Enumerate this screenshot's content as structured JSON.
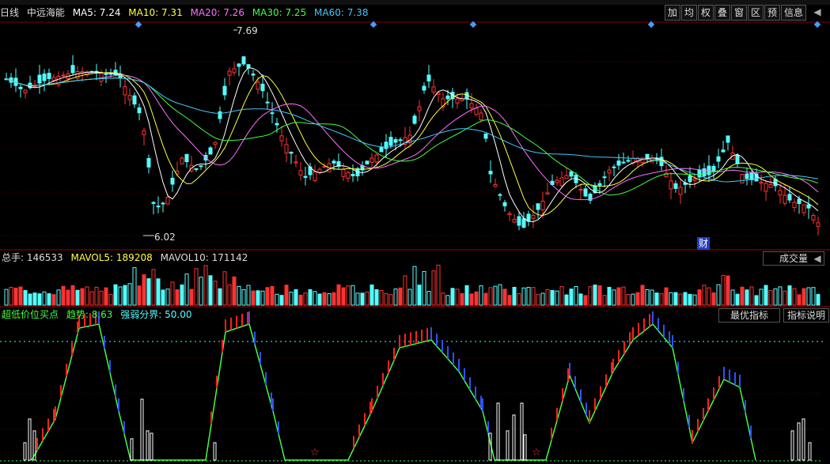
{
  "header": {
    "period": "日线",
    "stock": "中远海能",
    "ma": [
      {
        "label": "MA5: 7.24",
        "color": "#ffffff"
      },
      {
        "label": "MA10: 7.31",
        "color": "#ffff40"
      },
      {
        "label": "MA20: 7.26",
        "color": "#ff70ff"
      },
      {
        "label": "MA30: 7.25",
        "color": "#40ff40"
      },
      {
        "label": "MA60: 7.38",
        "color": "#40c8ff"
      }
    ]
  },
  "toolbar": [
    "加",
    "均",
    "权",
    "叠",
    "窗",
    "区",
    "预",
    "信息"
  ],
  "price": {
    "high_label": "7.69",
    "low_label": "6.02",
    "cai_badge": "财"
  },
  "volume": {
    "label": "总手: 146533",
    "mavol5": "MAVOL5: 189208",
    "mavol10": "MAVOL10: 171142",
    "tab": "成交量"
  },
  "indicator": {
    "name": "超低价位买点",
    "trend": "趋势: 8.63",
    "divider": "强弱分界: 50.00",
    "tab1": "最优指标",
    "tab2": "指标说明"
  },
  "colors": {
    "up": "#ff3232",
    "down": "#54ffff",
    "bg": "#000000",
    "grid": "#800000"
  }
}
